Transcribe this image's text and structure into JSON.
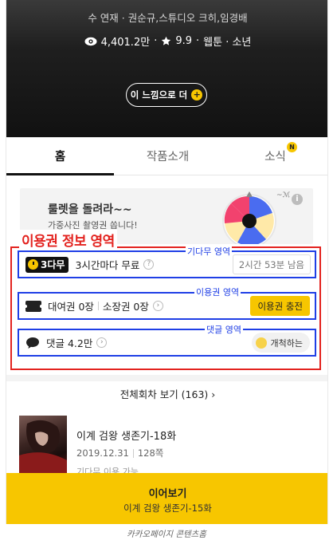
{
  "hero": {
    "authors": "수 연재 · 권순규,스튜디오 크히,임경배",
    "views": "4,401.2만",
    "rating": "9.9",
    "genre": "웹툰 · 소년",
    "more_button": "이 느낌으로 더"
  },
  "tabs": [
    {
      "label": "홈",
      "active": true
    },
    {
      "label": "작품소개",
      "active": false
    },
    {
      "label": "소식",
      "active": false,
      "badge": "N"
    }
  ],
  "banner": {
    "title": "룰렛을 돌려라~~",
    "subtitle": "가중사진 촬영권 쏩니다!"
  },
  "overlay": {
    "title": "이용권 정보 영역",
    "labels": {
      "gidamu": "기다무 영역",
      "ticket": "이용권 영역",
      "comment": "댓글 영역"
    }
  },
  "gidamu": {
    "badge": "3다무",
    "text": "3시간마다 무료",
    "help": "?",
    "remaining": "2시간 53분 남음"
  },
  "ticket": {
    "rental": "대여권 0장",
    "owned": "소장권 0장",
    "charge_button": "이용권 충전"
  },
  "comment": {
    "count": "댓글 4.2만",
    "pioneer_button": "개척하는"
  },
  "episodes": {
    "all_label": "전체회차 보기 (163)",
    "chevron": "›",
    "item": {
      "title": "이계 검왕 생존기-18화",
      "date": "2019.12.31",
      "pages": "128쪽",
      "note": "기다무 이용 가능"
    }
  },
  "continue": {
    "title": "이어보기",
    "subtitle": "이계 검왕 생존기-15화"
  },
  "caption": "카카오페이지 콘텐츠홈",
  "colors": {
    "accent": "#f7c600",
    "annotation_red": "#e3231f",
    "annotation_blue": "#1f3fe6"
  }
}
